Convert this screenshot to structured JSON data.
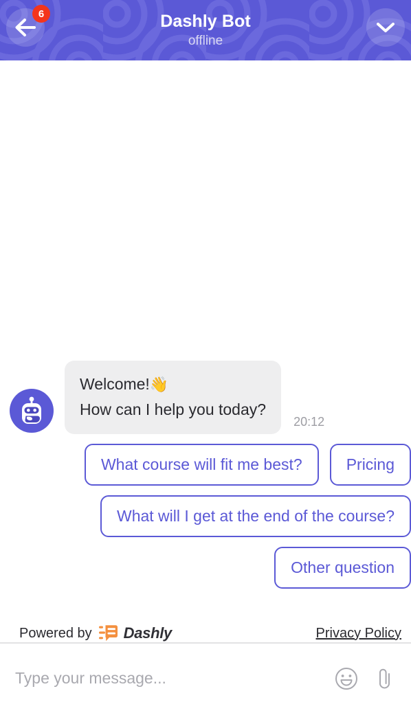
{
  "header": {
    "title": "Dashly Bot",
    "subtitle": "offline",
    "back_badge_count": "6",
    "back_icon": "arrow-left-icon",
    "collapse_icon": "chevron-down-icon",
    "background_color": "#5b59d6",
    "badge_color": "#f4351b"
  },
  "conversation": {
    "avatar_icon": "bot-avatar-icon",
    "message": {
      "line1": "Welcome!",
      "emoji": "👋",
      "line2": "How can I help you today?",
      "timestamp": "20:12",
      "bubble_color": "#eeeeef"
    },
    "quick_replies": {
      "accent_color": "#5b59d6",
      "rows": [
        [
          "What course will fit me best?",
          "Pricing"
        ],
        [
          "What will I get at the end of the course?"
        ],
        [
          "Other question"
        ]
      ]
    }
  },
  "footer": {
    "powered_by_text": "Powered by",
    "brand_name": "Dashly",
    "brand_mark_icon": "dashly-logo-icon",
    "brand_mark_color": "#f4903f",
    "privacy_link": "Privacy Policy"
  },
  "composer": {
    "placeholder": "Type your message...",
    "value": "",
    "emoji_icon": "smiley-face-icon",
    "attach_icon": "paperclip-icon"
  }
}
